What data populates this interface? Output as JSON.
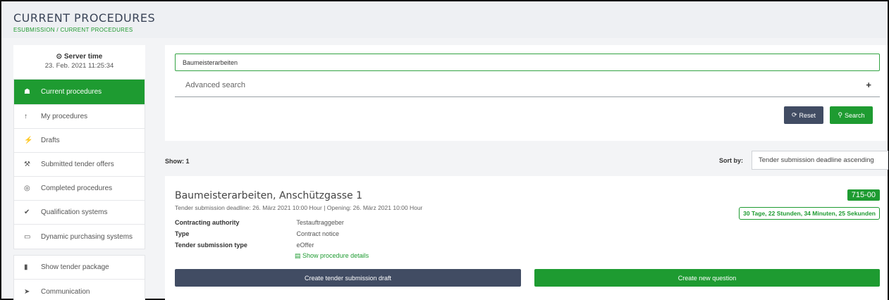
{
  "header": {
    "title": "CURRENT PROCEDURES",
    "breadcrumb": [
      "ESUBMISSION",
      "/ CURRENT PROCEDURES"
    ]
  },
  "sidebar": {
    "server_time_label": "Server time",
    "server_time_value": "23. Feb. 2021 11:25:34",
    "items": [
      {
        "label": "Current procedures",
        "icon": "home-icon",
        "active": true
      },
      {
        "label": "My procedures",
        "icon": "up-arrow-icon"
      },
      {
        "label": "Drafts",
        "icon": "magic-wand-icon"
      },
      {
        "label": "Submitted tender offers",
        "icon": "gavel-icon"
      },
      {
        "label": "Completed procedures",
        "icon": "eye-icon"
      },
      {
        "label": "Qualification systems",
        "icon": "check-icon"
      },
      {
        "label": "Dynamic purchasing systems",
        "icon": "folder-icon"
      }
    ],
    "items2": [
      {
        "label": "Show tender package",
        "icon": "bookmark-icon"
      },
      {
        "label": "Communication",
        "icon": "send-icon"
      }
    ]
  },
  "search": {
    "value": "Baumeisterarbeiten",
    "advanced_label": "Advanced search",
    "advanced_toggle": "+",
    "reset_label": "Reset",
    "search_label": "Search"
  },
  "results": {
    "show_label": "Show: 1",
    "sort_label": "Sort by:",
    "sort_value": "Tender submission deadline ascending"
  },
  "procedure": {
    "title": "Baumeisterarbeiten, Anschützgasse 1",
    "deadline": "Tender submission deadline: 26. März 2021 10:00 Hour | Opening: 26. März 2021 10:00 Hour",
    "id": "715-00",
    "countdown": "30 Tage, 22 Stunden, 34 Minuten, 25 Sekunden",
    "fields": [
      {
        "key": "Contracting authority",
        "value": "Testauftraggeber"
      },
      {
        "key": "Type",
        "value": "Contract notice"
      },
      {
        "key": "Tender submission type",
        "value": "eOffer"
      }
    ],
    "details_link": "Show procedure details",
    "draft_button": "Create tender submission draft",
    "question_button": "Create new question"
  },
  "colors": {
    "accent": "#1e9b31",
    "dark_button": "#414c63"
  }
}
